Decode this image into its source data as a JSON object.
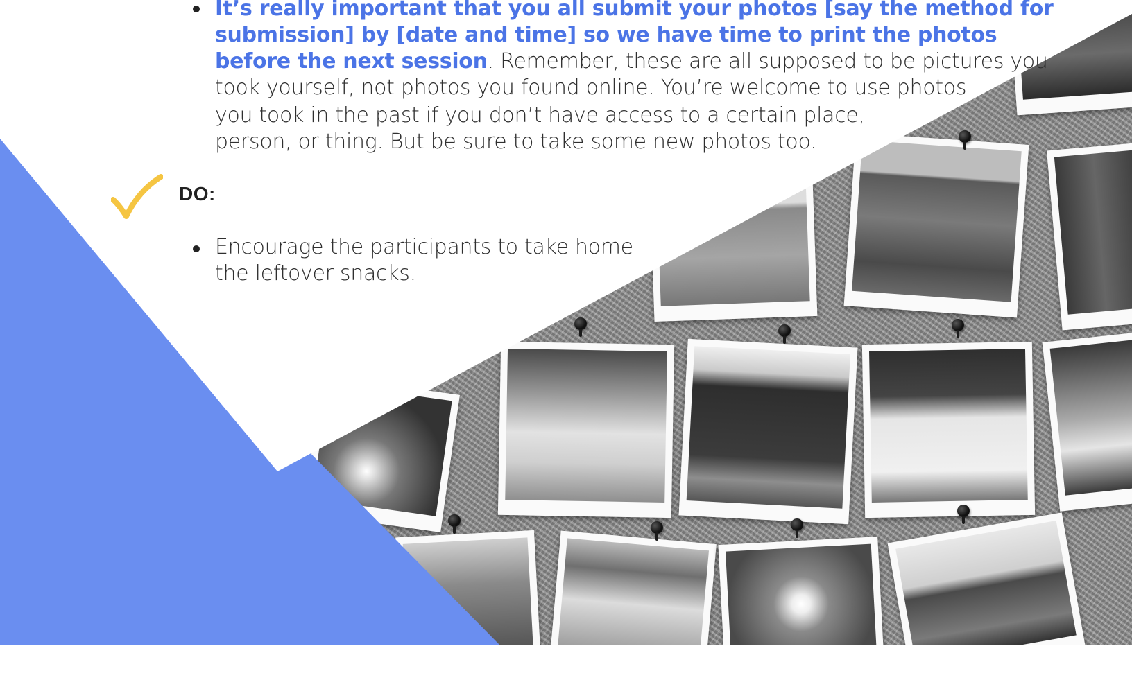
{
  "section1": {
    "bullet_lines": [
      "It’s really important that you all submit your photos [say the method for",
      "submission] by [date and time] so we have time to print the photos"
    ],
    "line3_bold": "before the next session",
    "line3_rest": ". Remember, these are all supposed to be pictures you",
    "line4": "took yourself, not photos you found online. You’re welcome to use photos",
    "line5": "you took in the past if you don’t have access to a certain place,",
    "line6": "person, or thing. But be sure to take some new photos too."
  },
  "do_section": {
    "heading": "DO:",
    "check_icon_color": "#f5c542",
    "bullet_lines": [
      "Encourage the participants to take home",
      "the leftover snacks."
    ]
  },
  "colors": {
    "accent_blue": "#4b74e6",
    "triangle_blue": "#6a8ef0"
  }
}
